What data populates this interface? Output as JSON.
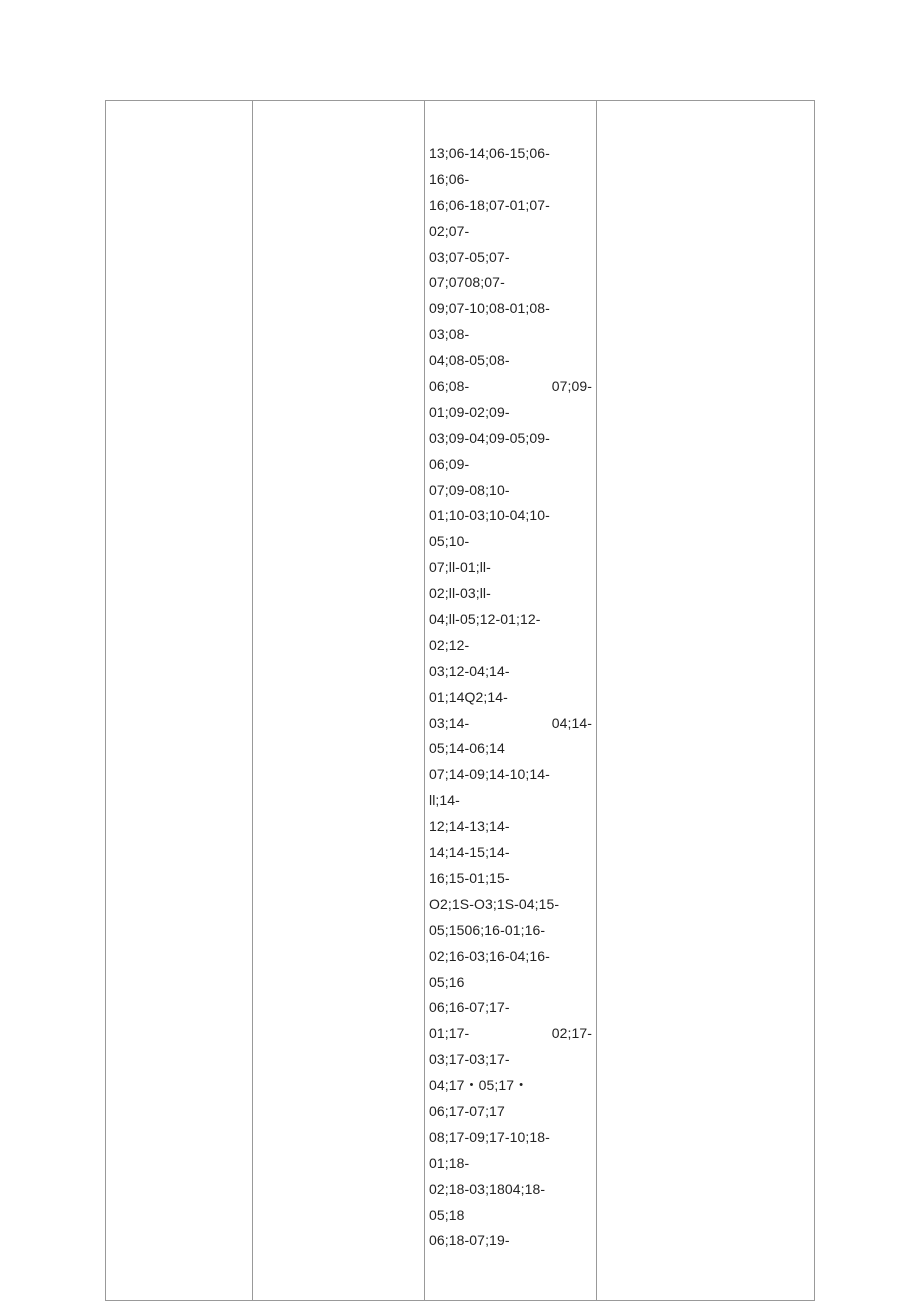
{
  "lines": [
    {
      "text": "13;06-14;06-15;06-"
    },
    {
      "text": "16;06-"
    },
    {
      "text": "16;06-18;07-01;07-"
    },
    {
      "text": "02;07-"
    },
    {
      "text": "03;07-05;07-"
    },
    {
      "text": "07;0708;07-"
    },
    {
      "text": "09;07-10;08-01;08-"
    },
    {
      "text": "03;08-"
    },
    {
      "text": "04;08-05;08-"
    },
    {
      "spread": true,
      "left": "06;08-",
      "right": "07;09-"
    },
    {
      "text": "01;09-02;09-"
    },
    {
      "text": "03;09-04;09-05;09-"
    },
    {
      "text": "06;09-"
    },
    {
      "text": "07;09-08;10-"
    },
    {
      "text": "01;10-03;10-04;10-"
    },
    {
      "text": "05;10-"
    },
    {
      "text": "07;ll-01;ll-"
    },
    {
      "text": "02;ll-03;ll-"
    },
    {
      "text": "04;ll-05;12-01;12-"
    },
    {
      "text": "02;12-"
    },
    {
      "text": "03;12-04;14-"
    },
    {
      "text": "01;14Q2;14-"
    },
    {
      "spread": true,
      "left": "03;14-",
      "right": "04;14-"
    },
    {
      "text": "05;14-06;14"
    },
    {
      "text": "07;14-09;14-10;14-"
    },
    {
      "text": "ll;14-"
    },
    {
      "text": "12;14-13;14-"
    },
    {
      "text": "14;14-15;14-"
    },
    {
      "text": "16;15-01;15-"
    },
    {
      "text": "O2;1S-O3;1S-04;15-"
    },
    {
      "text": "05;1506;16-01;16-"
    },
    {
      "text": "02;16-03;16-04;16-"
    },
    {
      "text": "05;16"
    },
    {
      "text": "06;16-07;17-"
    },
    {
      "spread": true,
      "left": "01;17-",
      "right": "02;17-"
    },
    {
      "text": "03;17-03;17-"
    },
    {
      "text": "04;17・05;17・"
    },
    {
      "text": "06;17-07;17"
    },
    {
      "text": "08;17-09;17-10;18-"
    },
    {
      "text": "01;18-"
    },
    {
      "text": "02;18-03;1804;18-"
    },
    {
      "text": "05;18"
    },
    {
      "text": "06;18-07;19-"
    }
  ]
}
